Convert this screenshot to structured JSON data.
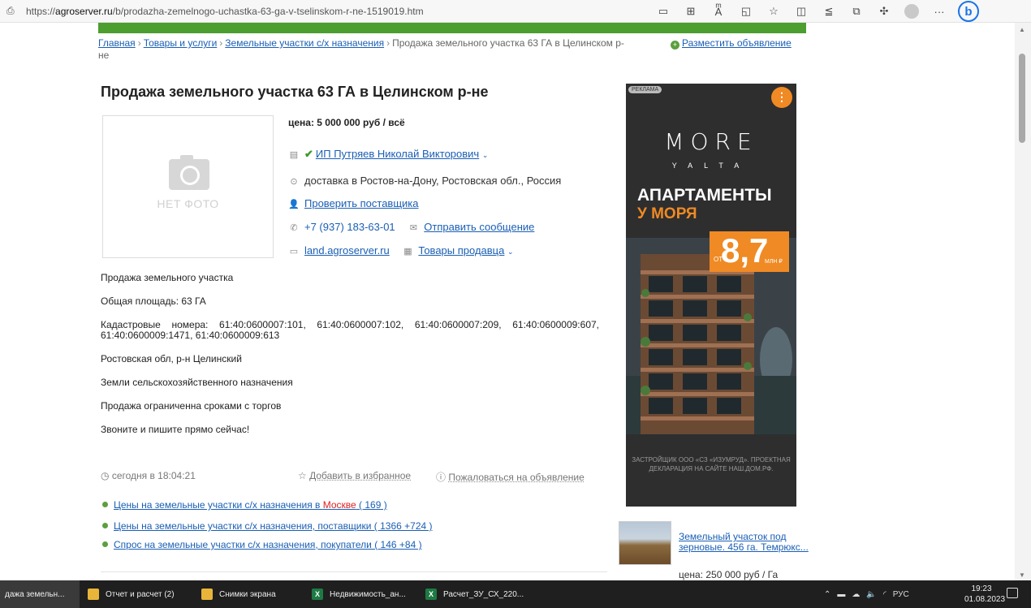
{
  "browser": {
    "url_prefix": "https://",
    "url_domain": "agroserver.ru",
    "url_path": "/b/prodazha-zemelnogo-uchastka-63-ga-v-tselinskom-r-ne-1519019.htm",
    "toolbar_icons": [
      "reader-icon",
      "apps-icon",
      "read-aloud-icon",
      "tab-icon",
      "favorite-icon",
      "split-icon",
      "favorites-list-icon",
      "collections-icon",
      "extensions-icon"
    ],
    "more_label": "···",
    "bing_label": "b"
  },
  "breadcrumb": {
    "items": [
      "Главная",
      "Товары и услуги",
      "Земельные участки с/х назначения"
    ],
    "current": "Продажа земельного участка 63 ГА в Целинском р-не",
    "separator": "›"
  },
  "post_ad": {
    "label": "Разместить объявление"
  },
  "listing": {
    "title": "Продажа земельного участка 63 ГА в Целинском р-не",
    "no_photo": "НЕТ ФОТО",
    "price": "цена: 5 000 000 руб / всё",
    "seller": "ИП Путряев Николай Викторович",
    "delivery": "доставка в Ростов-на-Дону, Ростовская обл., Россия",
    "check_supplier": "Проверить поставщика",
    "phone": "+7 (937) 183-63-01",
    "send_message": "Отправить сообщение",
    "site": "land.agroserver.ru",
    "seller_goods": "Товары продавца"
  },
  "description": {
    "lines": [
      "Продажа земельного участка",
      "Общая площадь: 63 ГА",
      "Кадастровые номера: 61:40:0600007:101, 61:40:0600007:102, 61:40:0600007:209, 61:40:0600009:607, 61:40:0600009:1471, 61:40:0600009:613",
      "Ростовская обл, р-н Целинский",
      "Земли сельскохозяйственного назначения",
      "Продажа ограниченна сроками с торгов",
      "Звоните и пишите прямо сейчас!"
    ]
  },
  "meta": {
    "date": "сегодня в 18:04:21",
    "favorite": "Добавить в избранное",
    "complain": "Пожаловаться на объявление"
  },
  "links": [
    {
      "pre": "Цены на земельные участки с/х назначения в ",
      "hl": "Москве",
      "post": " ( 169 )"
    },
    {
      "pre": "Цены на земельные участки с/х назначения, поставщики ( 1366 +724 )",
      "hl": "",
      "post": ""
    },
    {
      "pre": "Спрос на земельные участки с/х назначения, покупатели ( 146 +84 )",
      "hl": "",
      "post": ""
    }
  ],
  "ad": {
    "tag": "РЕКЛАМА",
    "menu": "⋮",
    "brand": "MORE",
    "brand_sub": "YALTA",
    "headline_1": "АПАРТАМЕНТЫ",
    "headline_2": "У МОРЯ",
    "price_from": "ОТ",
    "price_value": "8,7",
    "price_unit": "МЛН ₽",
    "disclaimer": "ЗАСТРОЙЩИК ООО «СЗ «ИЗУМРУД». ПРОЕКТНАЯ ДЕКЛАРАЦИЯ НА САЙТЕ НАШ.ДОМ.РФ.",
    "colors": {
      "bg": "#2e2e2f",
      "accent": "#f08a24"
    }
  },
  "side_card": {
    "title": "Земельный участок под зерновые. 456 га. Темрюкс...",
    "price": "цена: 250 000 руб / Га"
  },
  "taskbar": {
    "tasks": [
      {
        "label": "дажа земельн...",
        "icon": "edge-icon"
      },
      {
        "label": "Отчет и расчет (2)",
        "icon": "folder-icon"
      },
      {
        "label": "Снимки экрана",
        "icon": "folder-icon"
      },
      {
        "label": "Недвижимость_ан...",
        "icon": "excel-icon"
      },
      {
        "label": "Расчет_ЗУ_СХ_220...",
        "icon": "excel-icon"
      }
    ],
    "lang": "РУС",
    "time": "19:23",
    "date": "01.08.2023"
  }
}
